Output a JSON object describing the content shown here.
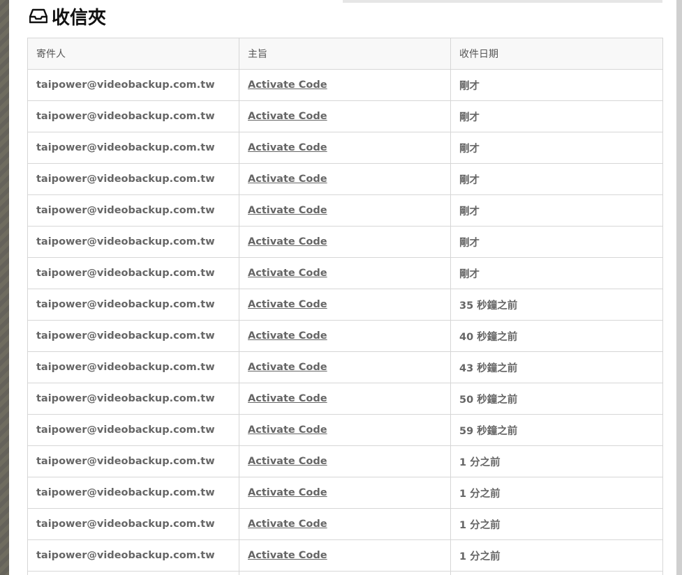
{
  "page": {
    "title": "收信夾",
    "icon": "inbox-icon"
  },
  "table": {
    "headers": {
      "sender": "寄件人",
      "subject": "主旨",
      "date": "收件日期"
    },
    "rows": [
      {
        "sender": "taipower@videobackup.com.tw",
        "subject": "Activate Code",
        "date": "剛才"
      },
      {
        "sender": "taipower@videobackup.com.tw",
        "subject": "Activate Code",
        "date": "剛才"
      },
      {
        "sender": "taipower@videobackup.com.tw",
        "subject": "Activate Code",
        "date": "剛才"
      },
      {
        "sender": "taipower@videobackup.com.tw",
        "subject": "Activate Code",
        "date": "剛才"
      },
      {
        "sender": "taipower@videobackup.com.tw",
        "subject": "Activate Code",
        "date": "剛才"
      },
      {
        "sender": "taipower@videobackup.com.tw",
        "subject": "Activate Code",
        "date": "剛才"
      },
      {
        "sender": "taipower@videobackup.com.tw",
        "subject": "Activate Code",
        "date": "剛才"
      },
      {
        "sender": "taipower@videobackup.com.tw",
        "subject": "Activate Code",
        "date": "35 秒鐘之前"
      },
      {
        "sender": "taipower@videobackup.com.tw",
        "subject": "Activate Code",
        "date": "40 秒鐘之前"
      },
      {
        "sender": "taipower@videobackup.com.tw",
        "subject": "Activate Code",
        "date": "43 秒鐘之前"
      },
      {
        "sender": "taipower@videobackup.com.tw",
        "subject": "Activate Code",
        "date": "50 秒鐘之前"
      },
      {
        "sender": "taipower@videobackup.com.tw",
        "subject": "Activate Code",
        "date": "59 秒鐘之前"
      },
      {
        "sender": "taipower@videobackup.com.tw",
        "subject": "Activate Code",
        "date": "1 分之前"
      },
      {
        "sender": "taipower@videobackup.com.tw",
        "subject": "Activate Code",
        "date": "1 分之前"
      },
      {
        "sender": "taipower@videobackup.com.tw",
        "subject": "Activate Code",
        "date": "1 分之前"
      },
      {
        "sender": "taipower@videobackup.com.tw",
        "subject": "Activate Code",
        "date": "1 分之前"
      },
      {
        "sender": "",
        "subject": "",
        "date": ""
      }
    ]
  }
}
